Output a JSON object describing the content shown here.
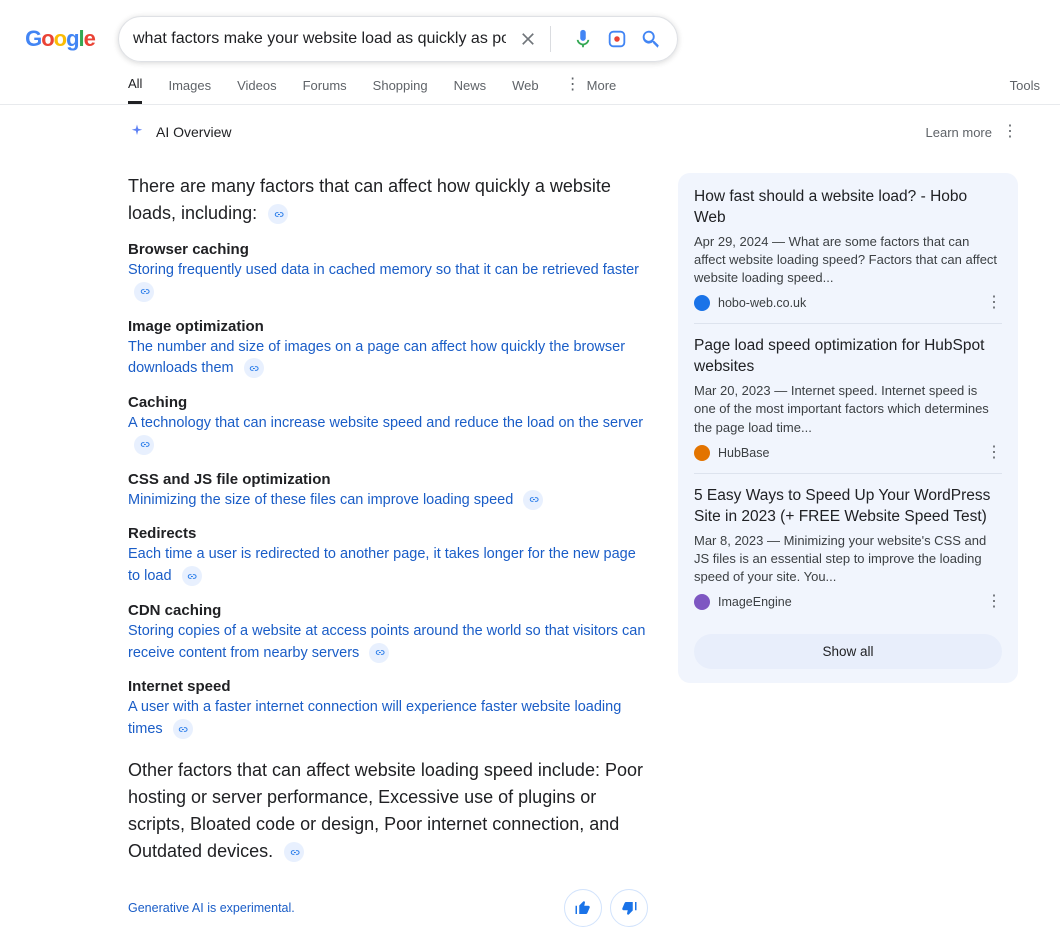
{
  "search": {
    "query": "what factors make your website load as quickly as possible"
  },
  "tabs": {
    "all": "All",
    "images": "Images",
    "videos": "Videos",
    "forums": "Forums",
    "shopping": "Shopping",
    "news": "News",
    "web": "Web",
    "more": "More",
    "tools": "Tools"
  },
  "ai": {
    "title": "AI Overview",
    "learn_more": "Learn more",
    "intro": "There are many factors that can affect how quickly a website loads, including:",
    "factors": [
      {
        "title": "Browser caching",
        "desc": "Storing frequently used data in cached memory so that it can be retrieved faster"
      },
      {
        "title": "Image optimization",
        "desc": "The number and size of images on a page can affect how quickly the browser downloads them"
      },
      {
        "title": "Caching",
        "desc": "A technology that can increase website speed and reduce the load on the server"
      },
      {
        "title": "CSS and JS file optimization",
        "desc": "Minimizing the size of these files can improve loading speed"
      },
      {
        "title": "Redirects",
        "desc": "Each time a user is redirected to another page, it takes longer for the new page to load"
      },
      {
        "title": "CDN caching",
        "desc": "Storing copies of a website at access points around the world so that visitors can receive content from nearby servers"
      },
      {
        "title": "Internet speed",
        "desc": "A user with a faster internet connection will experience faster website loading times"
      }
    ],
    "outro": "Other factors that can affect website loading speed include: Poor hosting or server performance, Excessive use of plugins or scripts, Bloated code or design, Poor internet connection, and Outdated devices.",
    "disclaimer": "Generative AI is experimental."
  },
  "side": {
    "cards": [
      {
        "title": "How fast should a website load? - Hobo Web",
        "snippet": "Apr 29, 2024 — What are some factors that can affect website loading speed? Factors that can affect website loading speed...",
        "source": "hobo-web.co.uk",
        "color": "blue"
      },
      {
        "title": "Page load speed optimization for HubSpot websites",
        "snippet": "Mar 20, 2023 — Internet speed. Internet speed is one of the most important factors which determines the page load time...",
        "source": "HubBase",
        "color": "orange"
      },
      {
        "title": "5 Easy Ways to Speed Up Your WordPress Site in 2023 (+ FREE Website Speed Test)",
        "snippet": "Mar 8, 2023 — Minimizing your website's CSS and JS files is an essential step to improve the loading speed of your site. You...",
        "source": "ImageEngine",
        "color": "purple"
      }
    ],
    "show_all": "Show all"
  }
}
